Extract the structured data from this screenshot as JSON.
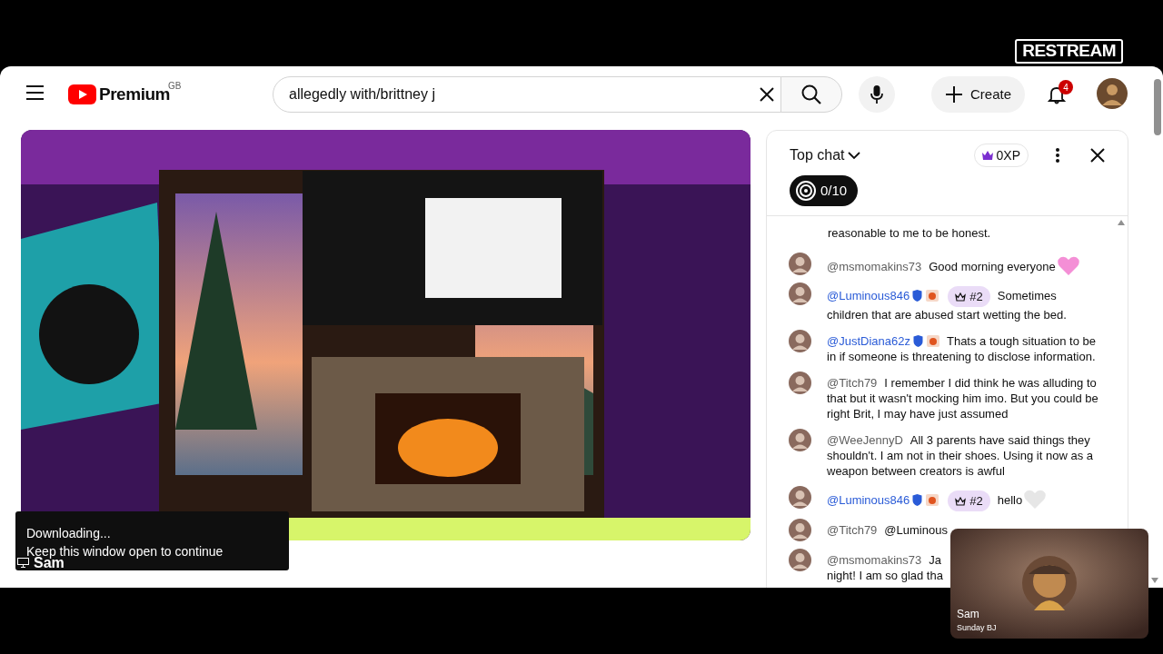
{
  "brand": {
    "logo_text": "RESTREAM"
  },
  "header": {
    "product": "Premium",
    "region": "GB",
    "search": {
      "value": "allegedly with/brittney j"
    },
    "create_label": "Create",
    "notifications": "4"
  },
  "chat": {
    "title": "Top chat",
    "xp": "0XP",
    "goal": "0/10",
    "messages": [
      {
        "kind": "continuation",
        "text": "reasonable to me to be honest."
      },
      {
        "kind": "message",
        "author": "@msmomakins73",
        "member": false,
        "verified": false,
        "sticker": false,
        "text": "Good morning everyone",
        "heart": {
          "color": "#f48fd6"
        }
      },
      {
        "kind": "message",
        "author": "@Luminous846",
        "member": true,
        "verified": true,
        "sticker": true,
        "rank": "#2",
        "text": "Sometimes children that are abused start wetting the bed."
      },
      {
        "kind": "message",
        "author": "@JustDiana62z",
        "member": true,
        "verified": true,
        "sticker": true,
        "text": "Thats a tough situation to be in if someone is threatening to disclose information."
      },
      {
        "kind": "message",
        "author": "@Titch79",
        "member": false,
        "verified": false,
        "sticker": false,
        "text": "I remember I did think he was alluding to that but it wasn't mocking him imo. But you could be right Brit, I may have just assumed"
      },
      {
        "kind": "message",
        "author": "@WeeJennyD",
        "member": false,
        "verified": false,
        "sticker": false,
        "text": "All 3 parents have said things they shouldn't. I am not in their shoes. Using it now as a weapon between creators is awful"
      },
      {
        "kind": "message",
        "author": "@Luminous846",
        "member": true,
        "verified": true,
        "sticker": true,
        "rank": "#2",
        "text": "hello",
        "heart": {
          "color": "#e6e6e6"
        }
      },
      {
        "kind": "message",
        "author": "@Titch79",
        "member": false,
        "verified": false,
        "sticker": false,
        "text": "@Luminous"
      },
      {
        "kind": "message",
        "author": "@msmomakins73",
        "member": false,
        "verified": false,
        "sticker": false,
        "text": "Ja",
        "next_line": "night! I am so glad tha"
      }
    ]
  },
  "toast": {
    "lines": [
      "Downloading...",
      "Keep this window open to continue"
    ],
    "presenter": "Sam"
  },
  "floating_tile": {
    "name": "Sam",
    "subtitle": "Sunday BJ"
  }
}
